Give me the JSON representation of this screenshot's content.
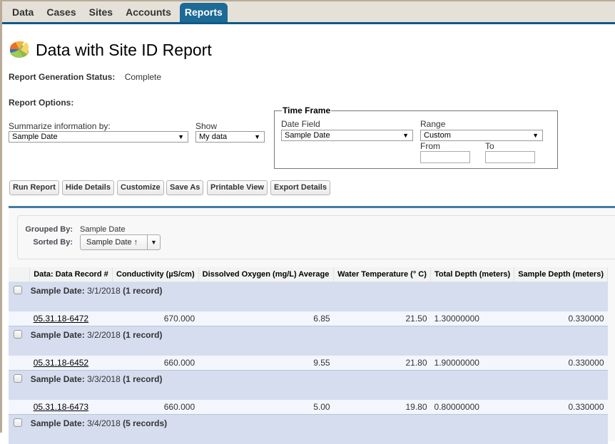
{
  "nav": {
    "tabs": [
      {
        "label": "Data",
        "active": false
      },
      {
        "label": "Cases",
        "active": false
      },
      {
        "label": "Sites",
        "active": false
      },
      {
        "label": "Accounts",
        "active": false
      },
      {
        "label": "Reports",
        "active": true
      }
    ]
  },
  "header": {
    "icon": "report-pie-chart-icon",
    "title": "Data with Site ID Report",
    "status_label": "Report Generation Status:",
    "status_value": "Complete"
  },
  "options": {
    "label": "Report Options:",
    "summarize_label": "Summarize information by:",
    "summarize_value": "Sample Date",
    "show_label": "Show",
    "show_value": "My data",
    "time_frame": {
      "legend": "Time Frame",
      "date_field_label": "Date Field",
      "date_field_value": "Sample Date",
      "range_label": "Range",
      "range_value": "Custom",
      "from_label": "From",
      "from_value": "",
      "to_label": "To",
      "to_value": ""
    }
  },
  "buttons": {
    "run_report": "Run Report",
    "hide_details": "Hide Details",
    "customize": "Customize",
    "save_as": "Save As",
    "printable_view": "Printable View",
    "export_details": "Export Details"
  },
  "grouping": {
    "grouped_by_label": "Grouped By:",
    "grouped_by_value": "Sample Date",
    "sorted_by_label": "Sorted By:",
    "sorted_by_value": "Sample Date ↑",
    "sort_dropdown_icon": "▼"
  },
  "table": {
    "columns": [
      "Data: Data Record #",
      "Conductivity (µS/cm)",
      "Dissolved Oxygen (mg/L) Average",
      "Water Temperature (° C)",
      "Total Depth (meters)",
      "Sample Depth (meters)"
    ],
    "groups": [
      {
        "label": "Sample Date:",
        "value": "3/1/2018",
        "count": "(1 record)",
        "rows": [
          {
            "record": "05.31.18-6472",
            "conductivity": "670.000",
            "oxygen": "6.85",
            "temperature": "21.50",
            "total_depth": "1.30000000",
            "sample_depth": "0.330000"
          }
        ]
      },
      {
        "label": "Sample Date:",
        "value": "3/2/2018",
        "count": "(1 record)",
        "rows": [
          {
            "record": "05.31.18-6452",
            "conductivity": "660.000",
            "oxygen": "9.55",
            "temperature": "21.80",
            "total_depth": "1.90000000",
            "sample_depth": "0.330000"
          }
        ]
      },
      {
        "label": "Sample Date:",
        "value": "3/3/2018",
        "count": "(1 record)",
        "rows": [
          {
            "record": "05.31.18-6473",
            "conductivity": "660.000",
            "oxygen": "5.00",
            "temperature": "19.80",
            "total_depth": "0.80000000",
            "sample_depth": "0.330000"
          }
        ]
      },
      {
        "label": "Sample Date:",
        "value": "3/4/2018",
        "count": "(5 records)",
        "rows": []
      }
    ]
  },
  "colors": {
    "nav_accent": "#0d5a86",
    "active_tab": "#1d6a96",
    "group_row": "#d5ddef",
    "detail_row": "#f3f6fd"
  }
}
